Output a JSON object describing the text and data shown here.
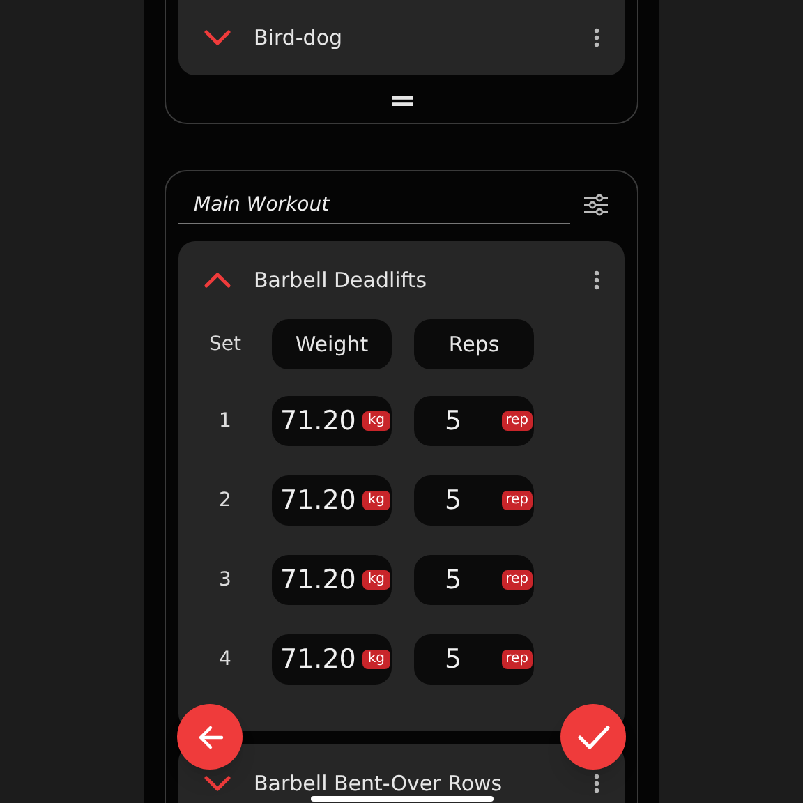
{
  "warmup": {
    "exercises": [
      {
        "name": "Bird-dog",
        "expanded": false
      }
    ]
  },
  "main": {
    "title": "Main Workout",
    "exercises": [
      {
        "name": "Barbell Deadlifts",
        "expanded": true,
        "columns": [
          "Set",
          "Weight",
          "Reps"
        ],
        "sets": [
          {
            "set": "1",
            "weight": "71.20",
            "weight_unit": "kg",
            "reps": "5",
            "reps_unit": "rep"
          },
          {
            "set": "2",
            "weight": "71.20",
            "weight_unit": "kg",
            "reps": "5",
            "reps_unit": "rep"
          },
          {
            "set": "3",
            "weight": "71.20",
            "weight_unit": "kg",
            "reps": "5",
            "reps_unit": "rep"
          },
          {
            "set": "4",
            "weight": "71.20",
            "weight_unit": "kg",
            "reps": "5",
            "reps_unit": "rep"
          }
        ]
      },
      {
        "name": "Barbell Bent-Over Rows",
        "expanded": false
      }
    ]
  }
}
